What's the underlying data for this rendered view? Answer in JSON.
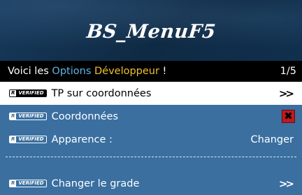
{
  "banner": {
    "title": "BS_MenuF5"
  },
  "subtitle": {
    "prefix": "Voici les ",
    "highlight_blue": "Options",
    "highlight_yellow": "Développeur",
    "suffix": " !",
    "counter": "1/5"
  },
  "badge": {
    "r": "R",
    "verified": "VERIFIED"
  },
  "items": [
    {
      "label": "TP sur coordonnées",
      "right": ">>",
      "selected": true
    },
    {
      "label": "Coordonnées",
      "right_icon": "close-x-icon"
    },
    {
      "label": "Apparence :",
      "right": "Changer"
    },
    {
      "label": "Changer le grade",
      "right": ">>"
    }
  ],
  "colors": {
    "banner": "#0f2a44",
    "body": "#3a6fa0",
    "accent_blue": "#5fb4e6",
    "accent_yellow": "#f0c030",
    "checkbox_red": "#c0191f"
  }
}
